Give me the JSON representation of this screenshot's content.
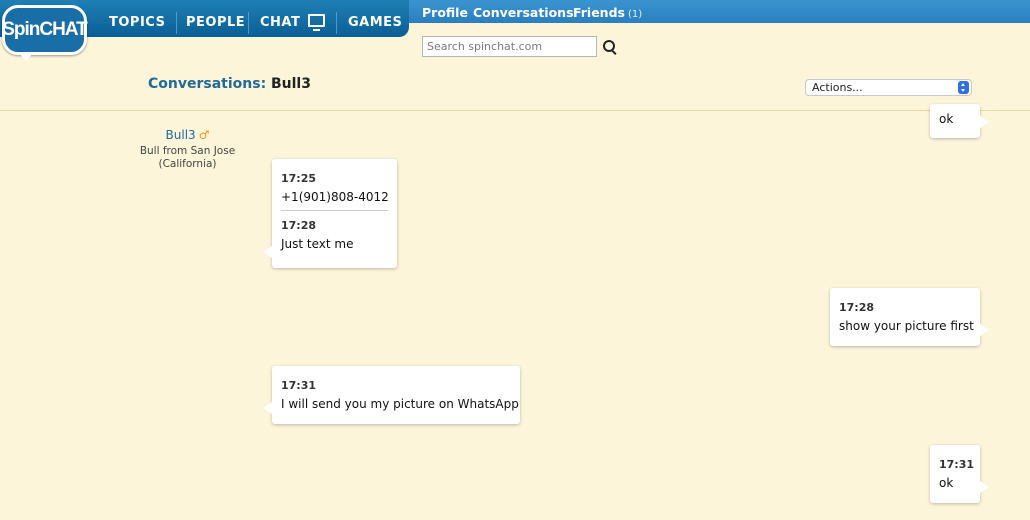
{
  "brand": {
    "logo_text": "SpinCHAT"
  },
  "nav": {
    "topics": "TOPICS",
    "people": "PEOPLE",
    "chat": "CHAT",
    "games": "GAMES"
  },
  "subnav": {
    "profile": "Profile",
    "conversations": "Conversations",
    "friends": "Friends",
    "friends_count": "(1)"
  },
  "search": {
    "placeholder": "Search spinchat.com"
  },
  "header": {
    "label": "Conversations:",
    "contact_name": "Bull3",
    "actions_label": "Actions..."
  },
  "contact": {
    "name": "Bull3",
    "gender_icon": "male-symbol-icon",
    "location_line1": "Bull from San Jose",
    "location_line2": "(California)"
  },
  "messages": [
    {
      "side": "right",
      "time": "",
      "text": "ok"
    },
    {
      "side": "left",
      "entries": [
        {
          "time": "17:25",
          "text": "+1(901)808-4012"
        },
        {
          "time": "17:28",
          "text": "Just text me"
        }
      ]
    },
    {
      "side": "right",
      "time": "17:28",
      "text": "show your picture first"
    },
    {
      "side": "left",
      "time": "17:31",
      "text": "I will send you my picture on WhatsApp"
    },
    {
      "side": "right",
      "time": "17:31",
      "text": "ok"
    }
  ],
  "colors": {
    "nav_blue": "#0a5f95",
    "subnav_blue": "#2a7fbf",
    "page_bg": "#fdf5da",
    "link_blue": "#1f6a99",
    "male_orange": "#e89a1c"
  }
}
